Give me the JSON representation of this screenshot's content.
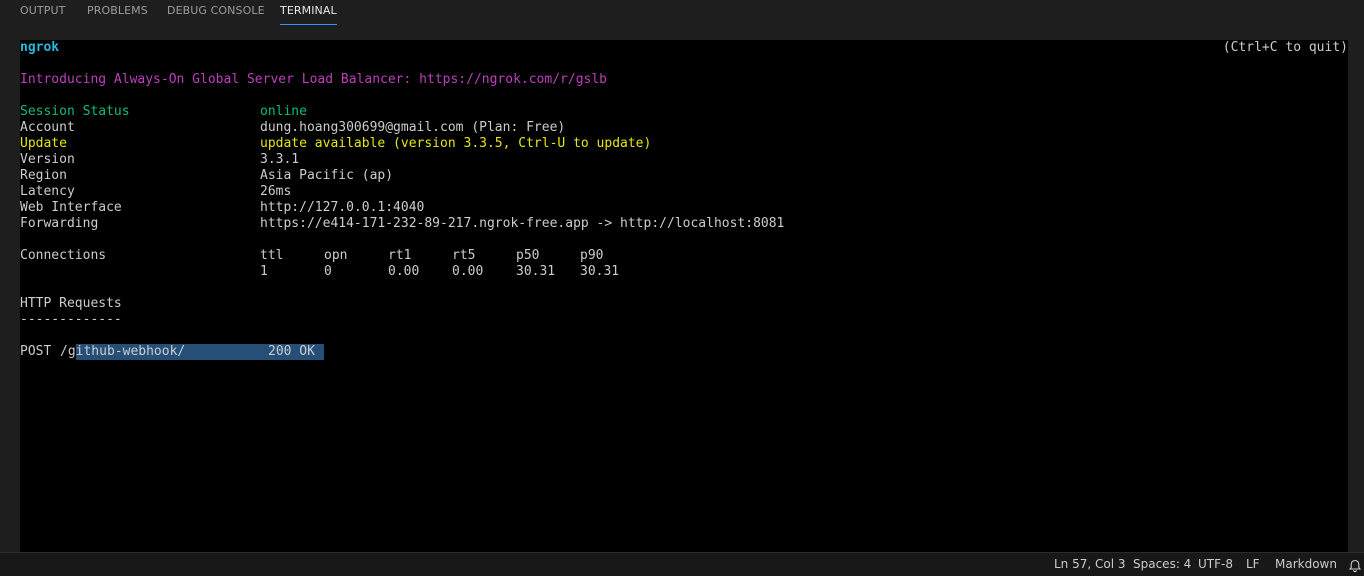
{
  "panel": {
    "tabs": [
      {
        "label": "OUTPUT"
      },
      {
        "label": "PROBLEMS"
      },
      {
        "label": "DEBUG CONSOLE"
      },
      {
        "label": "TERMINAL"
      }
    ],
    "active_tab": "TERMINAL"
  },
  "terminal": {
    "app_name": "ngrok",
    "quit_hint": "(Ctrl+C to quit)",
    "announcement": "Introducing Always-On Global Server Load Balancer: https://ngrok.com/r/gslb",
    "fields": [
      {
        "label": "Session Status",
        "value": "online"
      },
      {
        "label": "Account",
        "value": "dung.hoang300699@gmail.com (Plan: Free)"
      },
      {
        "label": "Update",
        "value": "update available (version 3.3.5, Ctrl-U to update)"
      },
      {
        "label": "Version",
        "value": "3.3.1"
      },
      {
        "label": "Region",
        "value": "Asia Pacific (ap)"
      },
      {
        "label": "Latency",
        "value": "26ms"
      },
      {
        "label": "Web Interface",
        "value": "http://127.0.0.1:4040"
      },
      {
        "label": "Forwarding",
        "value": "https://e414-171-232-89-217.ngrok-free.app -> http://localhost:8081"
      }
    ],
    "connections": {
      "label": "Connections",
      "headers": [
        "ttl",
        "opn",
        "rt1",
        "rt5",
        "p50",
        "p90"
      ],
      "values": [
        "1",
        "0",
        "0.00",
        "0.00",
        "30.31",
        "30.31"
      ]
    },
    "http_requests": {
      "title": "HTTP Requests",
      "divider": "-------------",
      "rows": [
        {
          "method": "POST",
          "path": "/github-webhook/",
          "status": "200 OK"
        }
      ]
    },
    "colors": {
      "app_name": "#29b8db",
      "announcement": "#bc3fbc",
      "online": "#23d18b",
      "update": "#e5e510",
      "selection": "#264f78"
    }
  },
  "statusbar": {
    "position": "Ln 57, Col 3",
    "spaces": "Spaces: 4",
    "encoding": "UTF-8",
    "eol": "LF",
    "language": "Markdown",
    "notification_icon": "bell-icon"
  }
}
